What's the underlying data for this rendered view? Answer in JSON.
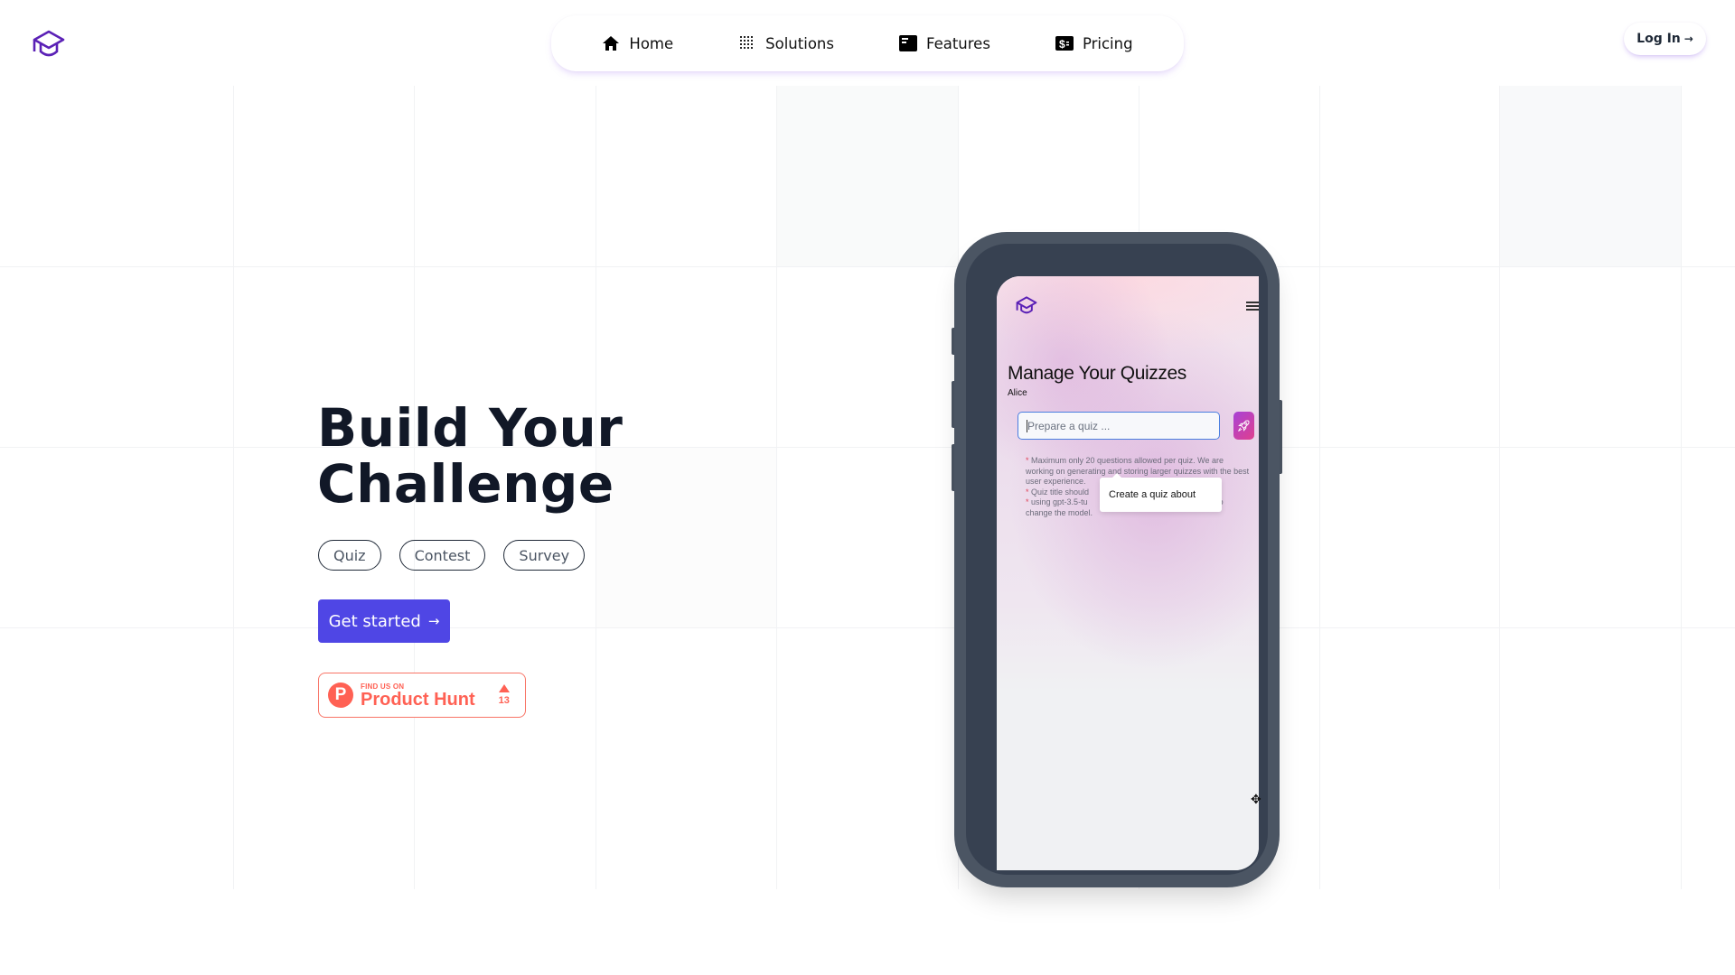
{
  "header": {
    "logo_icon": "graduation-cap-icon",
    "nav": [
      {
        "label": "Home",
        "icon": "home-icon"
      },
      {
        "label": "Solutions",
        "icon": "dot-grid-icon"
      },
      {
        "label": "Features",
        "icon": "features-card-icon"
      },
      {
        "label": "Pricing",
        "icon": "dollar-bill-icon"
      }
    ],
    "login_label": "Log In",
    "login_arrow": "→"
  },
  "hero": {
    "title_line1": "Build Your",
    "title_line2": "Challenge",
    "tags": [
      "Quiz",
      "Contest",
      "Survey"
    ],
    "cta_label": "Get started",
    "cta_arrow": "→",
    "product_hunt": {
      "small": "FIND US ON",
      "big": "Product Hunt",
      "logo_letter": "P",
      "votes": "13",
      "color": "#ff6154"
    }
  },
  "phone_screen": {
    "title": "Manage Your Quizzes",
    "user": "Alice",
    "input_placeholder": "Prepare a quiz ...",
    "send_icon": "rocket-icon",
    "notes": [
      "Maximum only 20 questions allowed per quiz. We are working on generating and storing larger quizzes with the best user experience.",
      "Quiz title should",
      "using gpt-3.5-tu",
      "to change the model."
    ],
    "tooltip": "Create a quiz about"
  },
  "colors": {
    "brand_purple": "#5b21b6",
    "cta": "#4f46e5",
    "text_dark": "#111827",
    "phone_frame": "#4b5563",
    "phone_bezel": "#374151"
  }
}
